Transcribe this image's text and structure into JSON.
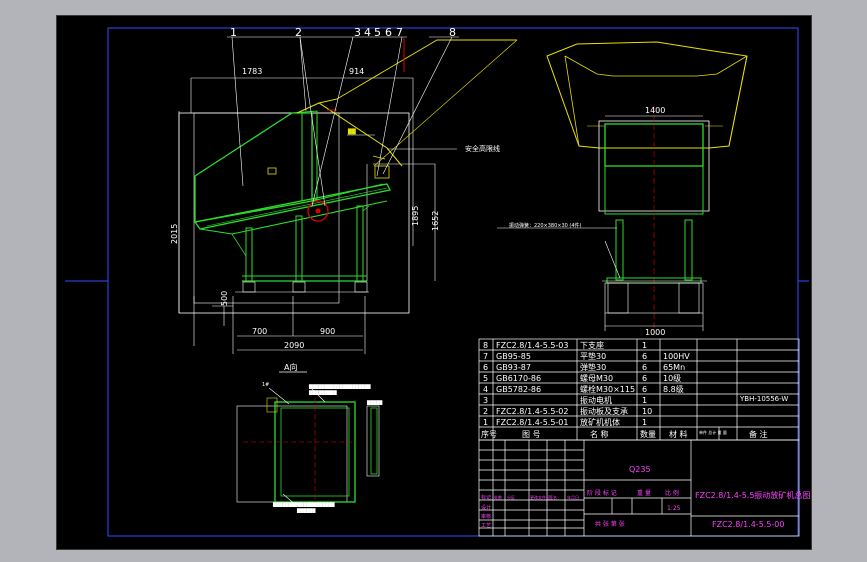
{
  "balloons": [
    "1",
    "2",
    "3",
    "4",
    "5",
    "6",
    "7",
    "8"
  ],
  "dims": {
    "d1783": "1783",
    "d914": "914",
    "d2015": "2015",
    "d1895": "1895",
    "d1652": "1652",
    "d500": "500",
    "d700": "700",
    "d900": "900",
    "d2090": "2090",
    "d1400": "1400",
    "d1000": "1000"
  },
  "labels": {
    "safety_line": "安全高限线",
    "view_a": "A向",
    "spring_note": "振动弹簧：220×380×30 (4件)",
    "right_marker": "YBH-10556-W"
  },
  "bom": {
    "rows": [
      {
        "no": "8",
        "code": "FZC2.8/1.4-5.5-03",
        "name": "下支座",
        "qty": "1",
        "mat": "",
        "wt": "",
        "note": ""
      },
      {
        "no": "7",
        "code": "GB95-85",
        "name": "平垫30",
        "qty": "6",
        "mat": "100HV",
        "wt": "",
        "note": ""
      },
      {
        "no": "6",
        "code": "GB93-87",
        "name": "弹垫30",
        "qty": "6",
        "mat": "65Mn",
        "wt": "",
        "note": ""
      },
      {
        "no": "5",
        "code": "GB6170-86",
        "name": "螺母M30",
        "qty": "6",
        "mat": "10级",
        "wt": "",
        "note": ""
      },
      {
        "no": "4",
        "code": "GB5782-86",
        "name": "螺栓M30×115",
        "qty": "6",
        "mat": "8.8级",
        "wt": "",
        "note": ""
      },
      {
        "no": "3",
        "code": "",
        "name": "振动电机",
        "qty": "1",
        "mat": "",
        "wt": "",
        "note": "YBH-10556-W"
      },
      {
        "no": "2",
        "code": "FZC2.8/1.4-5.5-02",
        "name": "振动板及支承",
        "qty": "10",
        "mat": "",
        "wt": "",
        "note": ""
      },
      {
        "no": "1",
        "code": "FZC2.8/1.4-5.5-01",
        "name": "放矿机机体",
        "qty": "1",
        "mat": "",
        "wt": "",
        "note": ""
      }
    ],
    "header": {
      "no": "序号",
      "code": "图 号",
      "name": "名 称",
      "qty": "数量",
      "mat": "材 料",
      "wt": "单件 总计 重 量",
      "note": "备 注"
    }
  },
  "title_block": {
    "material": "Q235",
    "drawing_name": "FZC2.8/1.4-5.5振动放矿机总图",
    "drawing_no": "FZC2.8/1.4-5.5-00",
    "stage_headers": [
      "阶 段 标 记",
      "重 量",
      "比 例"
    ],
    "scale": "1:25",
    "sheet": "共 张  第 张",
    "sign_rows": [
      "标记",
      "设计",
      "审核",
      "工艺"
    ],
    "sign_cols": [
      "处数",
      "分区",
      "更改文件号",
      "签名",
      "年月日"
    ]
  },
  "colors": {
    "bg": "#000000",
    "outer": "#b2b4b9",
    "white": "#ffffff",
    "green": "#2bdc2b",
    "yellow": "#e8e000",
    "magenta": "#ff40ff",
    "red": "#e00000",
    "blue": "#3050ff"
  }
}
